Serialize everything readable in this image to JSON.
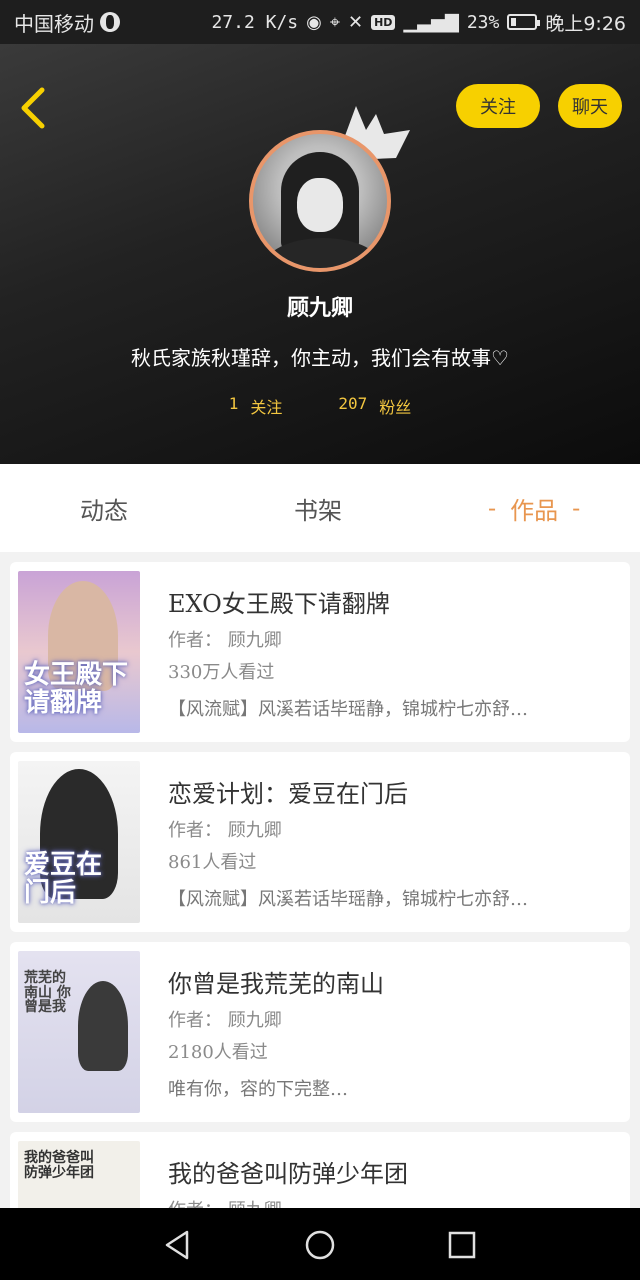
{
  "status_bar": {
    "carrier": "中国移动",
    "speed": "27.2 K/s",
    "battery": "23%",
    "time": "晚上9:26",
    "battery_level": 0.23
  },
  "header": {
    "follow_label": "关注",
    "chat_label": "聊天",
    "username": "顾九卿",
    "bio": "秋氏家族秋瑾辞，你主动，我们会有故事♡",
    "following_count": "1",
    "following_label": "关注",
    "followers_count": "207",
    "followers_label": "粉丝"
  },
  "tabs": [
    {
      "label": "动态",
      "active": false
    },
    {
      "label": "书架",
      "active": false
    },
    {
      "label": "作品",
      "active": true
    }
  ],
  "tab_active_dash": "-",
  "works": [
    {
      "title": "EXO女王殿下请翻牌",
      "author": "作者： 顾九卿",
      "views": "330万人看过",
      "desc": "【风流赋】风溪若话毕瑶静，锦城柠七亦舒…",
      "cover_text": "女王殿下请翻牌"
    },
    {
      "title": "恋爱计划：爱豆在门后",
      "author": "作者： 顾九卿",
      "views": "861人看过",
      "desc": "【风流赋】风溪若话毕瑶静，锦城柠七亦舒…",
      "cover_text": "爱豆在门后"
    },
    {
      "title": "你曾是我荒芜的南山",
      "author": "作者： 顾九卿",
      "views": "2180人看过",
      "desc": "唯有你，容的下完整…",
      "cover_text": "荒芜的南山 你曾是我"
    },
    {
      "title": "我的爸爸叫防弹少年团",
      "author": "作者： 顾九卿",
      "views": "",
      "desc": "",
      "cover_text": "我的爸爸叫防弹少年团"
    }
  ],
  "colors": {
    "accent_yellow": "#f7d000",
    "tab_active": "#e8964f",
    "stats": "#f2c640",
    "avatar_ring": "#e8966a"
  }
}
